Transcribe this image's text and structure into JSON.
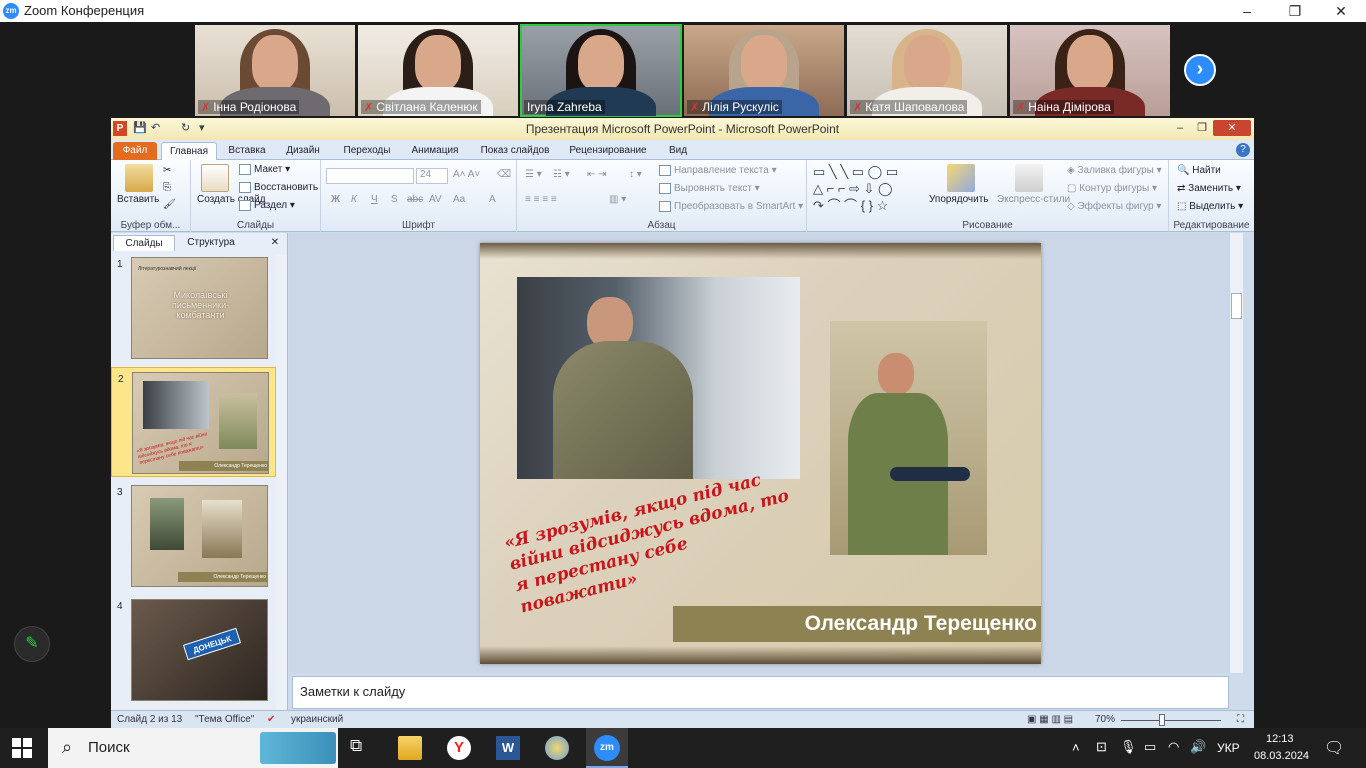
{
  "zoom": {
    "window_title": "Zoom Конференция",
    "logo": "zm",
    "participants": [
      {
        "name": "Інна Родіонова",
        "muted": true
      },
      {
        "name": "Світлана Каленюк",
        "muted": true
      },
      {
        "name": "Iryna Zahreba",
        "muted": false,
        "active": true
      },
      {
        "name": "Лілія Рускуліс",
        "muted": true
      },
      {
        "name": "Катя Шаповалова",
        "muted": true
      },
      {
        "name": "Наіна Дімірова",
        "muted": true
      }
    ],
    "next_icon": "chevron-right-icon",
    "window_buttons": {
      "minimize": "–",
      "maximize": "❐",
      "close": "✕"
    }
  },
  "powerpoint": {
    "title": "Презентация Microsoft PowerPoint  -  Microsoft PowerPoint",
    "app_icon": "P",
    "tabs": [
      "Файл",
      "Главная",
      "Вставка",
      "Дизайн",
      "Переходы",
      "Анимация",
      "Показ слайдов",
      "Рецензирование",
      "Вид"
    ],
    "active_tab": "Главная",
    "ribbon": {
      "clipboard": {
        "label": "Буфер обм...",
        "paste": "Вставить"
      },
      "slides": {
        "label": "Слайды",
        "create": "Создать слайд",
        "layout": "Макет",
        "reset": "Восстановить",
        "section": "Раздел"
      },
      "font": {
        "label": "Шрифт",
        "size": "24",
        "family": ""
      },
      "paragraph": {
        "label": "Абзац",
        "text_direction": "Направление текста",
        "align_text": "Выровнять текст",
        "smartart": "Преобразовать в SmartArt"
      },
      "drawing": {
        "label": "Рисование",
        "arrange": "Упорядочить",
        "quick_styles": "Экспресс-стили",
        "fill": "Заливка фигуры",
        "outline": "Контур фигуры",
        "effects": "Эффекты фигур"
      },
      "editing": {
        "label": "Редактирование",
        "find": "Найти",
        "replace": "Заменить",
        "select": "Выделить"
      }
    },
    "left_pane": {
      "tabs": [
        "Слайды",
        "Структура"
      ],
      "thumbnails": [
        {
          "num": "1",
          "title": "Миколаївські письменники-комбатанти",
          "header": "Літературознавчий лекції"
        },
        {
          "num": "2",
          "caption": "Олександр Терещенко",
          "quote": "«Я зрозумів, якщо під час війни відсиджусь вдома, то я перестану себе поважати»",
          "selected": true
        },
        {
          "num": "3",
          "caption": "Олександр Терещенко"
        },
        {
          "num": "4",
          "sign": "ДОНЕЦЬК"
        }
      ]
    },
    "slide": {
      "quote": "«Я зрозумів, якщо під час війни відсиджусь вдома, то я перестану себе поважати»",
      "name": "Олександр Терещенко"
    },
    "notes_placeholder": "Заметки к слайду",
    "status": {
      "slide": "Слайд 2 из 13",
      "theme": "\"Тема Office\"",
      "language": "украинский",
      "zoom": "70%"
    }
  },
  "taskbar": {
    "search_label": "Поиск",
    "language": "УКР",
    "time": "12:13",
    "date": "08.03.2024"
  },
  "colors": {
    "zoom_blue": "#2d8cff",
    "ppt_orange": "#e36c1f",
    "quote_red": "#c8161d",
    "name_bar": "#8f8252"
  }
}
